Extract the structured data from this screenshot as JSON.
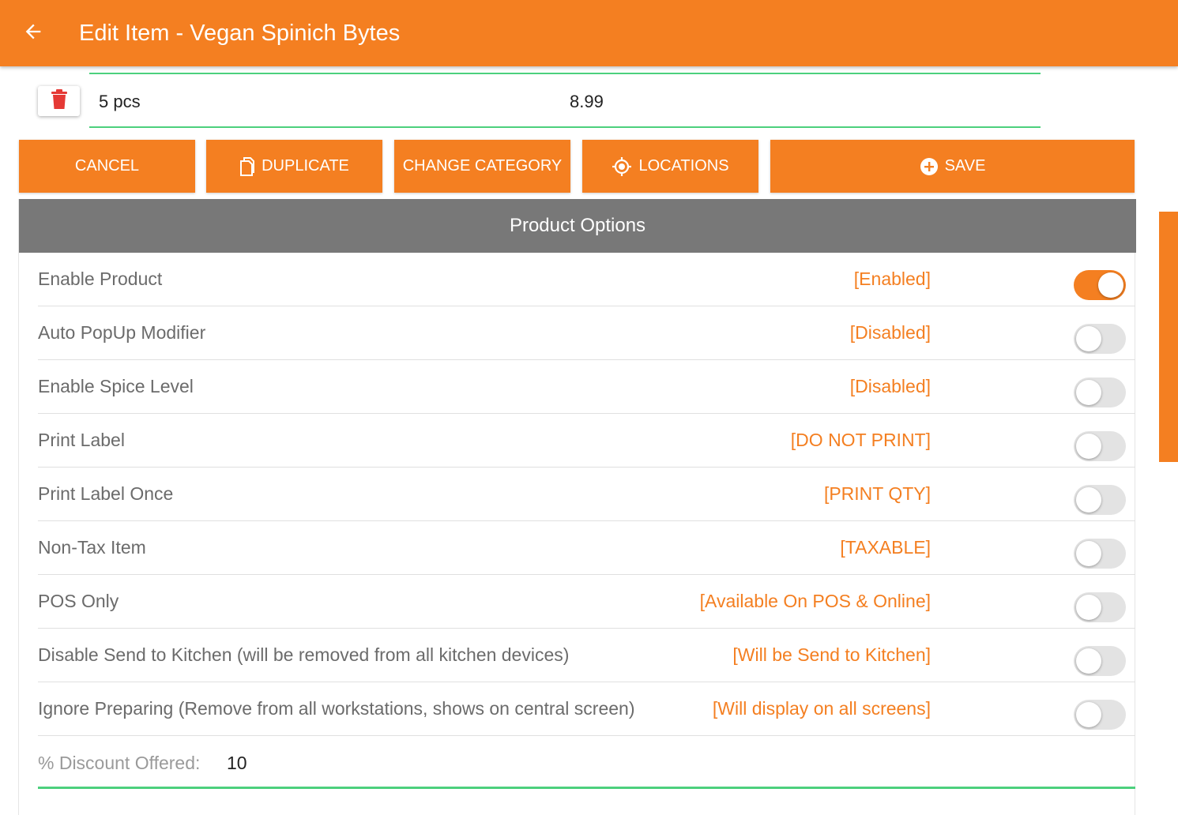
{
  "appbar": {
    "back_icon": "arrow-left-icon",
    "title": "Edit Item - Vegan Spinich Bytes"
  },
  "variant": {
    "delete_icon": "trash-icon",
    "name": "5 pcs",
    "price": "8.99"
  },
  "actions": {
    "cancel": "CANCEL",
    "duplicate": "DUPLICATE",
    "duplicate_icon": "file-copy-icon",
    "change_category": "CHANGE CATEGORY",
    "locations": "LOCATIONS",
    "locations_icon": "gps-target-icon",
    "save": "SAVE",
    "save_icon": "plus-circle-icon"
  },
  "product_options": {
    "title": "Product Options",
    "options": [
      {
        "label": "Enable Product",
        "status": "[Enabled]",
        "on": true
      },
      {
        "label": "Auto PopUp Modifier",
        "status": "[Disabled]",
        "on": false
      },
      {
        "label": "Enable Spice Level",
        "status": "[Disabled]",
        "on": false
      },
      {
        "label": "Print Label",
        "status": "[DO NOT PRINT]",
        "on": false
      },
      {
        "label": "Print Label Once",
        "status": "[PRINT QTY]",
        "on": false
      },
      {
        "label": "Non-Tax Item",
        "status": "[TAXABLE]",
        "on": false
      },
      {
        "label": "POS Only",
        "status": "[Available On POS & Online]",
        "on": false
      },
      {
        "label": "Disable Send to Kitchen (will be removed from all kitchen devices)",
        "status": "[Will be Send to Kitchen]",
        "on": false
      },
      {
        "label": "Ignore Preparing (Remove from all workstations, shows on central screen)",
        "status": "[Will display on all screens]",
        "on": false
      }
    ],
    "discount_label": "% Discount Offered:",
    "discount_value": "10"
  },
  "colors": {
    "accent": "#f47f21",
    "header_gray": "#787878",
    "underline_green": "#4cd07d",
    "delete_red": "#e53935"
  }
}
